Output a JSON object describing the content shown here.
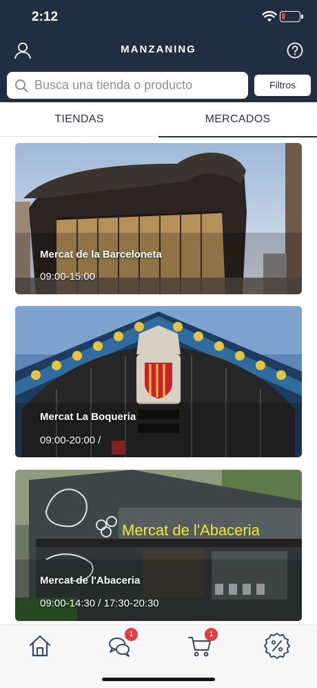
{
  "status_bar": {
    "time": "2:12"
  },
  "header": {
    "title": "MANZANING",
    "search_placeholder": "Busca una tienda o producto",
    "filter_label": "Filtros"
  },
  "tabs": [
    {
      "label": "TIENDAS",
      "selected": false
    },
    {
      "label": "MERCADOS",
      "selected": true
    }
  ],
  "markets": [
    {
      "name": "Mercat de la Barceloneta",
      "hours": "09:00-15:00"
    },
    {
      "name": "Mercat La Boqueria",
      "hours": "09:00-20:00 /"
    },
    {
      "name": "Mercat de l'Abaceria",
      "hours": "09:00-14:30 / 17:30-20:30",
      "sign_text": "Mercat de l'Abaceria"
    }
  ],
  "bottom_nav": [
    {
      "icon": "home-icon",
      "badge": ""
    },
    {
      "icon": "chat-icon",
      "badge": "1"
    },
    {
      "icon": "cart-icon",
      "badge": "1"
    },
    {
      "icon": "discount-icon",
      "badge": ""
    }
  ],
  "colors": {
    "header_bg": "#212d43",
    "accent": "#2e4a6b",
    "badge": "#e93b3b"
  }
}
